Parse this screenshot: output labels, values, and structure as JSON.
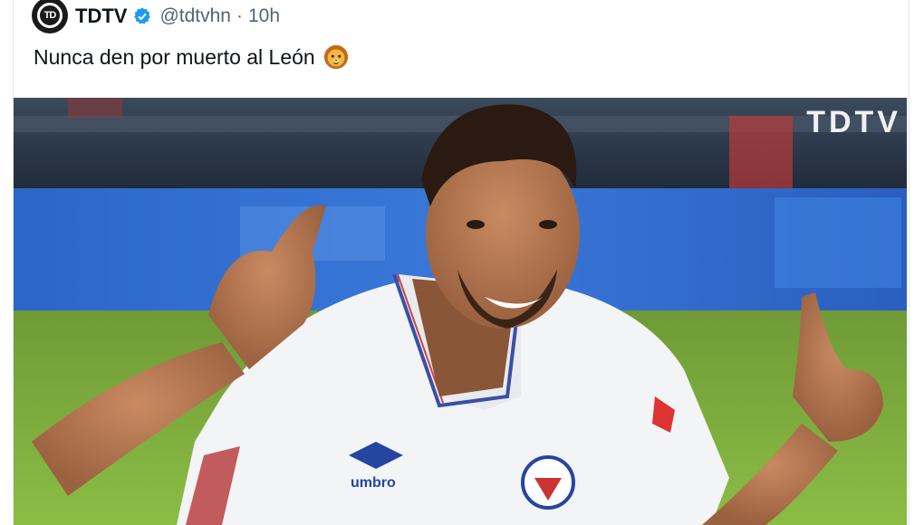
{
  "tweet": {
    "display_name": "TDTV",
    "handle": "@tdtvhn",
    "separator": "·",
    "time": "10h",
    "text": "Nunca den por muerto al León",
    "emoji_name": "lion-face-emoji"
  },
  "media": {
    "watermark": "TDTV",
    "description_icon": "photo-player-celebrating",
    "shirt_brand": "umbro"
  },
  "colors": {
    "verified": "#1d9bf0",
    "secondary_text": "#536471",
    "stadium_blue": "#2f5fb8",
    "pitch_green": "#7fae3a"
  }
}
